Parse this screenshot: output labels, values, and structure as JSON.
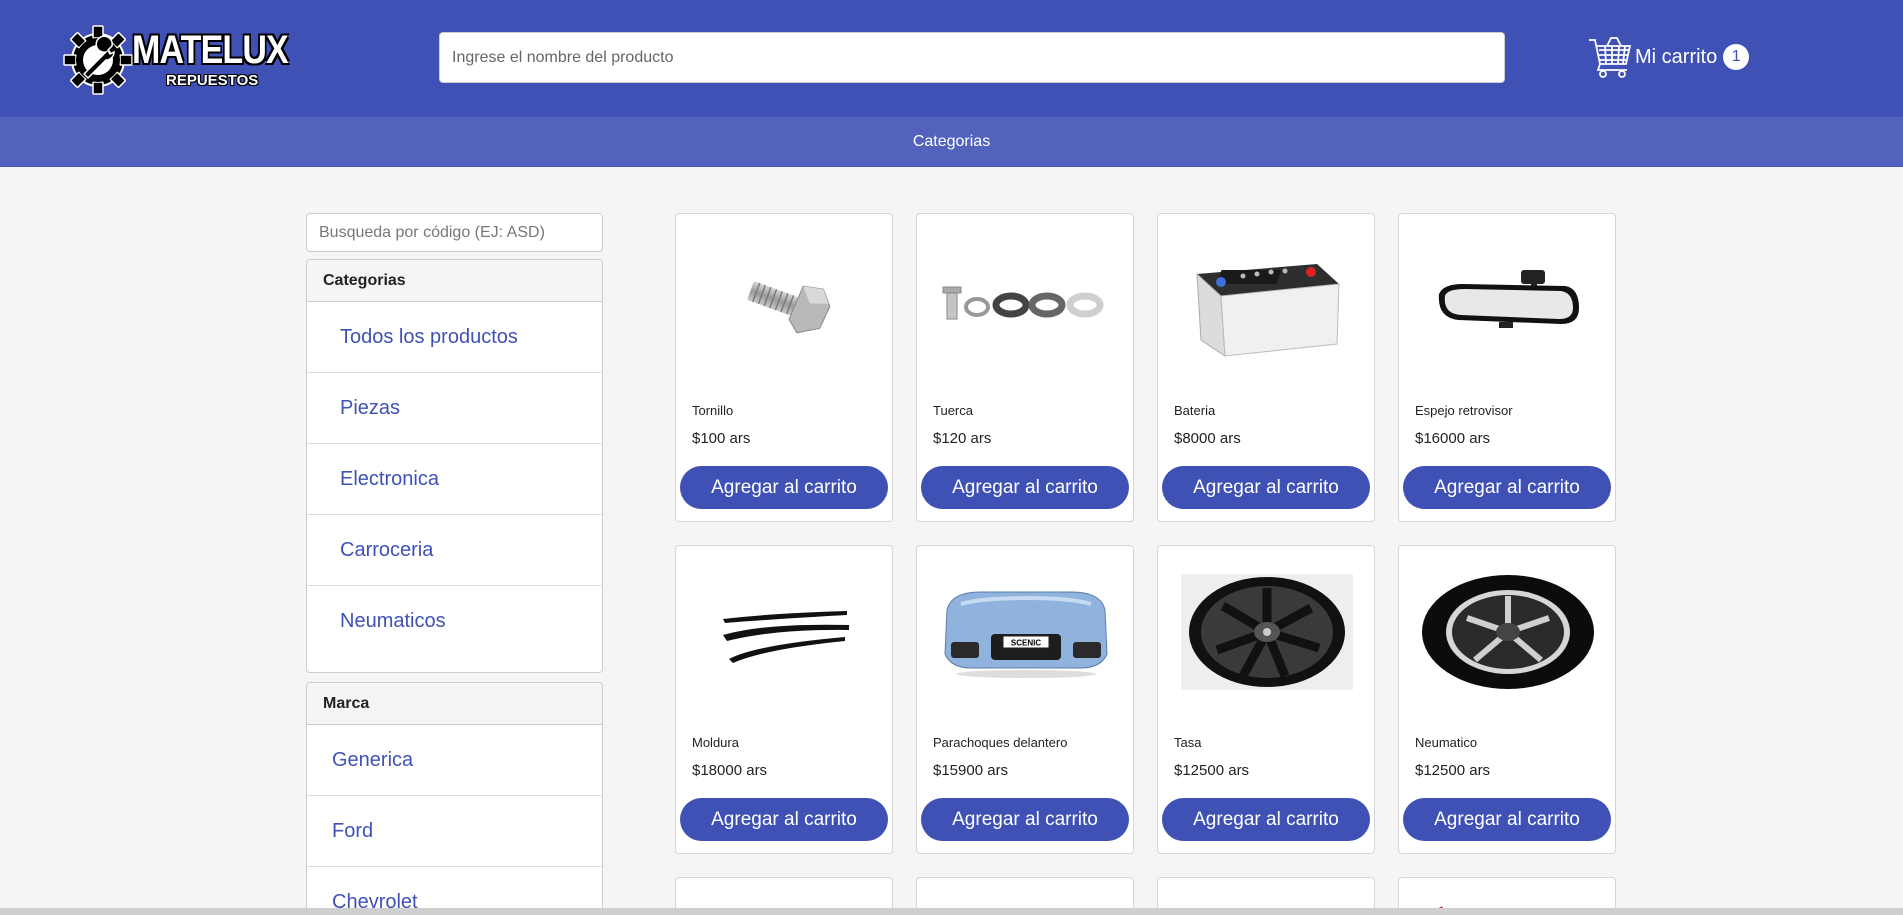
{
  "header": {
    "logo_title": "MATELUX",
    "logo_subtitle": "REPUESTOS",
    "search_placeholder": "Ingrese el nombre del producto",
    "cart_label": "Mi carrito",
    "cart_count": "1",
    "brand_color": "#3f51b5"
  },
  "navbar": {
    "categories_label": "Categorias"
  },
  "sidebar": {
    "code_search_placeholder": "Busqueda por código (EJ: ASD)",
    "categories_title": "Categorias",
    "categories": [
      "Todos los productos",
      "Piezas",
      "Electronica",
      "Carroceria",
      "Neumaticos"
    ],
    "brand_title": "Marca",
    "brands": [
      "Generica",
      "Ford",
      "Chevrolet"
    ]
  },
  "products": [
    {
      "name": "Tornillo",
      "price": "$100 ars",
      "button": "Agregar al carrito",
      "icon": "bolt-icon"
    },
    {
      "name": "Tuerca",
      "price": "$120 ars",
      "button": "Agregar al carrito",
      "icon": "washers-icon"
    },
    {
      "name": "Bateria",
      "price": "$8000 ars",
      "button": "Agregar al carrito",
      "icon": "battery-icon"
    },
    {
      "name": "Espejo retrovisor",
      "price": "$16000 ars",
      "button": "Agregar al carrito",
      "icon": "mirror-icon"
    },
    {
      "name": "Moldura",
      "price": "$18000 ars",
      "button": "Agregar al carrito",
      "icon": "molding-icon"
    },
    {
      "name": "Parachoques delantero",
      "price": "$15900 ars",
      "button": "Agregar al carrito",
      "icon": "bumper-icon",
      "plate_text": "SCENIC"
    },
    {
      "name": "Tasa",
      "price": "$12500 ars",
      "button": "Agregar al carrito",
      "icon": "rim-icon"
    },
    {
      "name": "Neumatico",
      "price": "$12500 ars",
      "button": "Agregar al carrito",
      "icon": "tire-icon"
    }
  ]
}
